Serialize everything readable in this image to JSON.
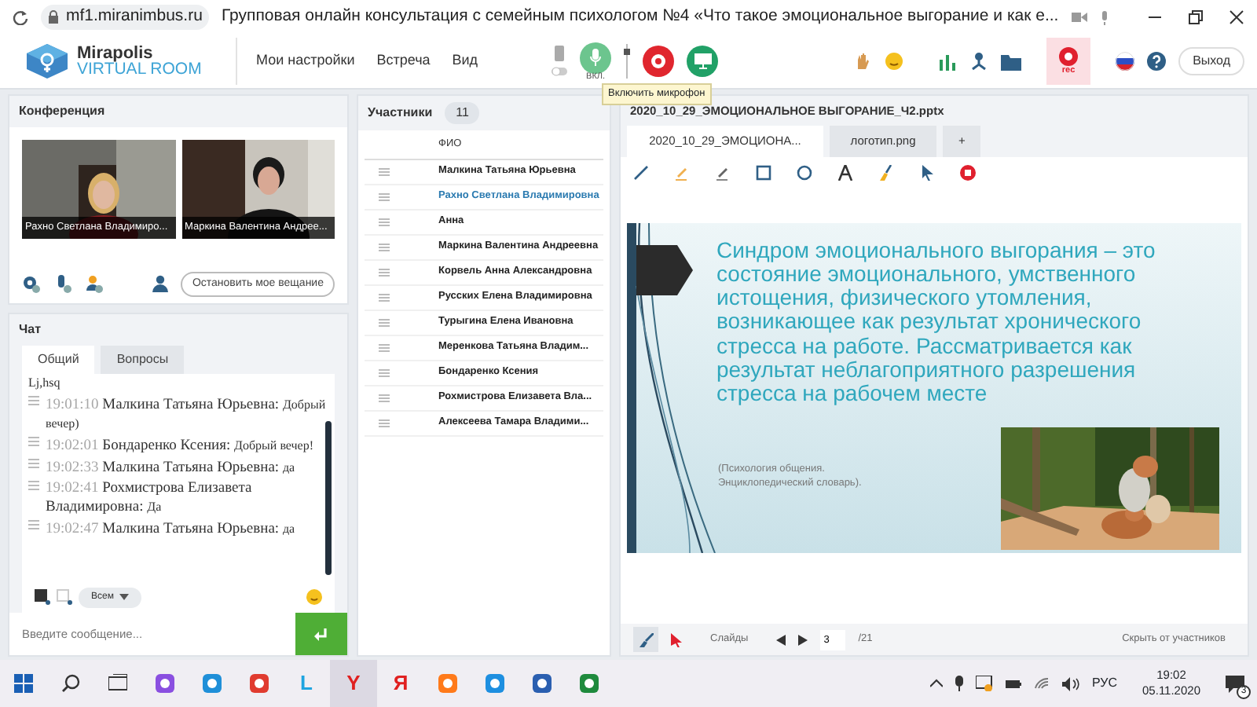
{
  "browser": {
    "url": "mf1.miranimbus.ru",
    "title": "Групповая онлайн консультация с семейным психологом №4 «Что такое эмоциональное выгорание и как е..."
  },
  "header": {
    "logo": {
      "line1": "Mirapolis",
      "line2": "VIRTUAL ROOM"
    },
    "menu": [
      "Мои настройки",
      "Встреча",
      "Вид"
    ],
    "mic": {
      "label": "ВКЛ.",
      "on": true
    },
    "tooltip": "Включить микрофон",
    "rec_label": "rec",
    "exit": "Выход"
  },
  "conference": {
    "title": "Конференция",
    "videos": [
      {
        "name": "Рахно Светлана  Владимиро..."
      },
      {
        "name": "Маркина Валентина  Андрее..."
      }
    ],
    "stop_button": "Остановить мое вещание"
  },
  "chat": {
    "title": "Чат",
    "tabs": [
      {
        "label": "Общий",
        "selected": true
      },
      {
        "label": "Вопросы",
        "selected": false
      }
    ],
    "messages": [
      {
        "kind": "fragment",
        "text": "Lj,hsq"
      },
      {
        "kind": "message",
        "time": "19:01:10",
        "author": "Малкина Татьяна  Юрьевна:",
        "text": "Добрый вечер)"
      },
      {
        "kind": "message",
        "time": "19:02:01",
        "author": "Бондаренко  Ксения:",
        "text": "Добрый вечер!"
      },
      {
        "kind": "message",
        "time": "19:02:33",
        "author": "Малкина Татьяна  Юрьевна:",
        "text": "да"
      },
      {
        "kind": "message",
        "time": "19:02:41",
        "author": "Рохмистрова  Елизавета Владимировна:",
        "text": "Да"
      },
      {
        "kind": "message",
        "time": "19:02:47",
        "author": "Малкина Татьяна  Юрьевна:",
        "text": "да"
      }
    ],
    "recipient": "Всем",
    "placeholder": "Введите сообщение..."
  },
  "participants": {
    "title": "Участники",
    "count": "11",
    "column": "ФИО",
    "rows": [
      {
        "name": "Малкина Татьяна  Юрьевна",
        "selected": false
      },
      {
        "name": "Рахно Светлана  Владимировна",
        "selected": true
      },
      {
        "name": "Анна",
        "selected": false
      },
      {
        "name": "Маркина Валентина  Андреевна",
        "selected": false
      },
      {
        "name": "Корвель Анна  Александровна",
        "selected": false
      },
      {
        "name": "Русских Елена Владимировна",
        "selected": false
      },
      {
        "name": "Турыгина  Елена  Ивановна",
        "selected": false
      },
      {
        "name": "Меренкова  Татьяна  Владим...",
        "selected": false
      },
      {
        "name": "Бондаренко  Ксения",
        "selected": false
      },
      {
        "name": "Рохмистрова  Елизавета Вла...",
        "selected": false
      },
      {
        "name": "Алексеева  Тамара  Владими...",
        "selected": false
      }
    ]
  },
  "presentation": {
    "title": "2020_10_29_ЭМОЦИОНАЛЬНОЕ ВЫГОРАНИЕ_Ч2.pptx",
    "tabs": [
      {
        "label": "2020_10_29_ЭМОЦИОНА...",
        "selected": true
      },
      {
        "label": "логотип.png",
        "selected": false
      },
      {
        "label": "+",
        "selected": false
      }
    ],
    "slide": {
      "text": "Синдром эмоционального выгорания – это состояние эмоционального, умственного истощения, физического утомления, возникающее как результат хронического стресса на работе. Рассматривается как результат неблагоприятного разрешения стресса на рабочем месте",
      "source": "(Психология общения. Энциклопедический словарь)."
    },
    "slides_label": "Слайды",
    "page": "3",
    "total": "/21",
    "hide": "Скрыть от участников"
  },
  "taskbar": {
    "apps": [
      {
        "kind": "shape",
        "color": "#8a4fe0",
        "active": false
      },
      {
        "kind": "shape",
        "color": "#1f8fd8",
        "active": false
      },
      {
        "kind": "shape",
        "color": "#e03b2f",
        "active": false
      },
      {
        "kind": "glyph",
        "text": "L",
        "color": "#1ea4e0",
        "active": false
      },
      {
        "kind": "glyph",
        "text": "Y",
        "color": "#e02020",
        "active": true
      },
      {
        "kind": "glyph",
        "text": "Я",
        "color": "#e02020",
        "active": false
      },
      {
        "kind": "shape",
        "color": "#ff7a1a",
        "active": false
      },
      {
        "kind": "shape",
        "color": "#1e8fe0",
        "active": false
      },
      {
        "kind": "shape",
        "color": "#2b5fb0",
        "active": false
      },
      {
        "kind": "shape",
        "color": "#1f8a3d",
        "active": false
      }
    ],
    "lang": "РУС",
    "time": "19:02",
    "date": "05.11.2020",
    "notifications": "3"
  }
}
